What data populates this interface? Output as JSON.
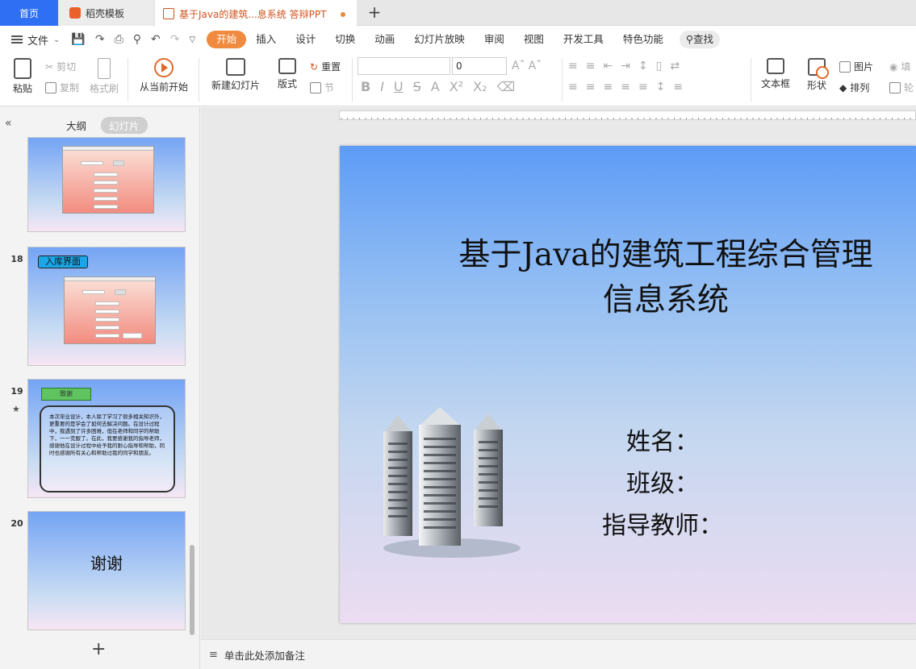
{
  "tabs": {
    "home": "首页",
    "template": "稻壳模板",
    "document": "基于Java的建筑...息系统 答辩PPT"
  },
  "menu": {
    "file": "文件",
    "tabs": [
      "开始",
      "插入",
      "设计",
      "切换",
      "动画",
      "幻灯片放映",
      "审阅",
      "视图",
      "开发工具",
      "特色功能"
    ],
    "active_tab": "开始",
    "search": "查找"
  },
  "ribbon": {
    "paste": "粘贴",
    "cut": "剪切",
    "copy": "复制",
    "format_painter": "格式刷",
    "play_from_current": "从当前开始",
    "new_slide": "新建幻灯片",
    "layout": "版式",
    "reset": "重置",
    "section": "节",
    "font_size": "0",
    "textbox": "文本框",
    "shape": "形状",
    "picture": "图片",
    "arrange": "排列",
    "fill": "填",
    "outline": "轮"
  },
  "left_panel": {
    "outline_tab": "大纲",
    "slides_tab": "幻灯片",
    "active_view": "幻灯片",
    "slides": [
      {
        "number": "18",
        "label": "入库界面"
      },
      {
        "number": "19",
        "banner": "致谢",
        "body": "本次毕业设计，本人除了学习了很多相关知识外，更重要的是学会了如何去解决问题。在设计过程中，我遇到了许多困难，但在老师和同学的帮助下，一一克服了。在此，我要感谢我的指导老师，感谢他在设计过程中给予我的耐心指导和帮助，同时也感谢所有关心和帮助过我的同学和朋友。"
      },
      {
        "number": "20",
        "text": "谢谢"
      }
    ]
  },
  "slide": {
    "title_line1": "基于Java的建筑工程综合管理",
    "title_line2": "信息系统",
    "name_label": "姓名：",
    "class_label": "班级：",
    "advisor_label": "指导教师："
  },
  "notes": {
    "placeholder": "单击此处添加备注"
  },
  "colors": {
    "accent": "#2e6ff3",
    "active_tab": "#f08a3e"
  }
}
